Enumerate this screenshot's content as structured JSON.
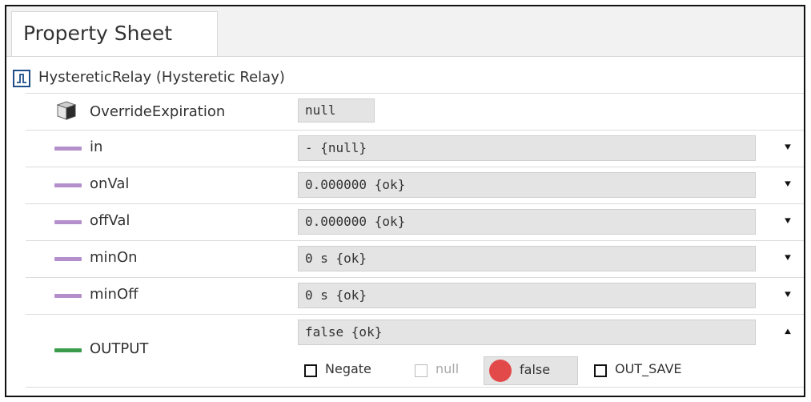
{
  "tab": {
    "title": "Property Sheet"
  },
  "root": {
    "icon": "relay-icon",
    "label": "HystereticRelay  (Hysteretic Relay)"
  },
  "colors": {
    "slot_bar": "#b48fcc",
    "output_bar": "#3a9b4a",
    "status_dot": "#e24a4a"
  },
  "properties": [
    {
      "name": "OverrideExpiration",
      "value": "null",
      "icon": "cube-icon"
    },
    {
      "name": "in",
      "value": "- {null}",
      "expand": "expand-icon"
    },
    {
      "name": "onVal",
      "value": "0.000000 {ok}",
      "expand": "expand-icon"
    },
    {
      "name": "offVal",
      "value": "0.000000 {ok}",
      "expand": "expand-icon"
    },
    {
      "name": "minOn",
      "value": "0 s {ok}",
      "expand": "expand-icon"
    },
    {
      "name": "minOff",
      "value": "0 s {ok}",
      "expand": "expand-icon"
    }
  ],
  "output": {
    "name": "OUTPUT",
    "value": "false {ok}",
    "collapse": "collapse-icon",
    "negate_label": "Negate",
    "null_label": "null",
    "status_label": "false",
    "outsave_label": "OUT_SAVE"
  }
}
